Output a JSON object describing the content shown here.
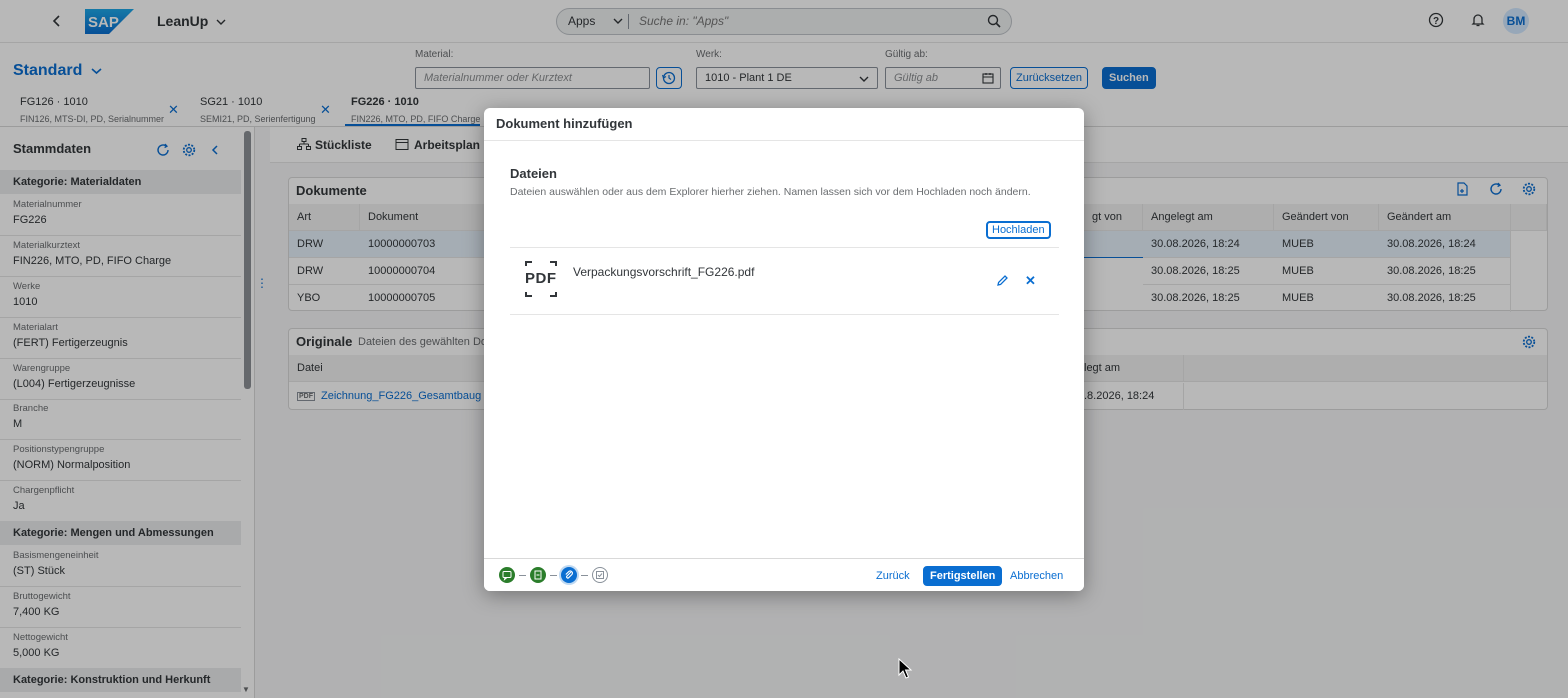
{
  "shell": {
    "app_title": "LeanUp",
    "search_scope": "Apps",
    "search_placeholder": "Suche in: \"Apps\"",
    "avatar_initials": "BM"
  },
  "filterbar": {
    "variant": "Standard",
    "material_label": "Material:",
    "material_placeholder": "Materialnummer oder Kurztext",
    "werk_label": "Werk:",
    "werk_value": "1010 - Plant 1 DE",
    "gueltig_label": "Gültig ab:",
    "gueltig_placeholder": "Gültig ab",
    "reset_label": "Zurücksetzen",
    "search_label": "Suchen"
  },
  "tabs": [
    {
      "title": "FG126 · 1010",
      "sub": "FIN126, MTS-DI, PD, Serialnummer"
    },
    {
      "title": "SG21 · 1010",
      "sub": "SEMI21, PD, Serienfertigung"
    },
    {
      "title": "FG226 · 1010",
      "sub": "FIN226, MTO, PD, FIFO Charge"
    }
  ],
  "leftpanel": {
    "title": "Stammdaten",
    "cat1": "Kategorie: Materialdaten",
    "fields": [
      {
        "label": "Materialnummer",
        "value": "FG226"
      },
      {
        "label": "Materialkurztext",
        "value": "FIN226, MTO, PD, FIFO Charge"
      },
      {
        "label": "Werke",
        "value": "1010"
      },
      {
        "label": "Materialart",
        "value": "(FERT) Fertigerzeugnis"
      },
      {
        "label": "Warengruppe",
        "value": "(L004) Fertigerzeugnisse"
      },
      {
        "label": "Branche",
        "value": "M"
      },
      {
        "label": "Positionstypengruppe",
        "value": "(NORM) Normalposition"
      },
      {
        "label": "Chargenpflicht",
        "value": "Ja"
      }
    ],
    "cat2": "Kategorie: Mengen und Abmessungen",
    "fields2": [
      {
        "label": "Basismengeneinheit",
        "value": "(ST) Stück"
      },
      {
        "label": "Bruttogewicht",
        "value": "7,400 KG"
      },
      {
        "label": "Nettogewicht",
        "value": "5,000 KG"
      }
    ],
    "cat3": "Kategorie: Konstruktion und Herkunft"
  },
  "subtabs": {
    "stueckliste": "Stückliste",
    "arbeitsplan": "Arbeitsplan"
  },
  "dokumente": {
    "title": "Dokumente",
    "headers": [
      "Art",
      "Dokument",
      "gt von",
      "Angelegt am",
      "Geändert von",
      "Geändert am"
    ],
    "rows": [
      {
        "art": "DRW",
        "dok": "10000000703",
        "angelegt": "30.08.2026, 18:24",
        "geaendert_von": "MUEB",
        "geaendert_am": "30.08.2026, 18:24"
      },
      {
        "art": "DRW",
        "dok": "10000000704",
        "angelegt": "30.08.2026, 18:25",
        "geaendert_von": "MUEB",
        "geaendert_am": "30.08.2026, 18:25"
      },
      {
        "art": "YBO",
        "dok": "10000000705",
        "angelegt": "30.08.2026, 18:25",
        "geaendert_von": "MUEB",
        "geaendert_am": "30.08.2026, 18:25"
      }
    ]
  },
  "originale": {
    "title": "Originale",
    "subtitle": "Dateien des gewählten Dok",
    "header_datei": "Datei",
    "header_angelegt": "legt am",
    "file": "Zeichnung_FG226_Gesamtbaug",
    "file_date": ".8.2026, 18:24"
  },
  "dialog": {
    "title": "Dokument hinzufügen",
    "section_title": "Dateien",
    "section_desc": "Dateien auswählen oder aus dem Explorer hierher ziehen. Namen lassen sich vor dem Hochladen noch ändern.",
    "upload_label": "Hochladen",
    "file_icon_text": "PDF",
    "file_name": "Verpackungsvorschrift_FG226.pdf",
    "back_label": "Zurück",
    "finish_label": "Fertigstellen",
    "cancel_label": "Abbrechen"
  },
  "colors": {
    "accent": "#0a6ed1",
    "step_done": "#2b7d2b",
    "step_active": "#0a6ed1"
  }
}
